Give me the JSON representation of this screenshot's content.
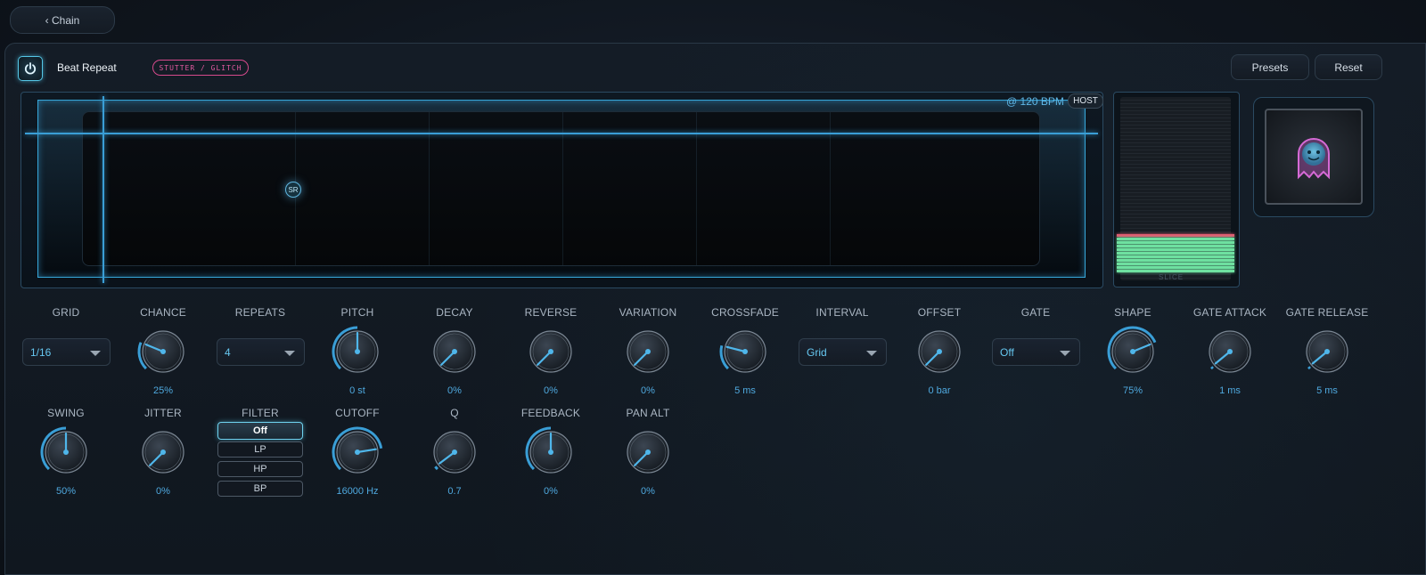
{
  "nav": {
    "back_label": "‹ Chain"
  },
  "header": {
    "title": "Beat Repeat",
    "tag": "STUTTER / GLITCH",
    "presets_label": "Presets",
    "reset_label": "Reset",
    "power_icon": "power-icon"
  },
  "display": {
    "bpm_text": "@ 120 BPM",
    "host_label": "HOST",
    "node_label": "SR",
    "slice_label": "SLICE"
  },
  "colors": {
    "accent": "#3a9ed6",
    "value_text": "#4fa9df",
    "tag": "#e25aa0",
    "meter_green": "#6fe0a0",
    "meter_red": "#e05a70"
  },
  "row1": [
    {
      "id": "grid",
      "label": "GRID",
      "type": "dropdown",
      "value": "1/16"
    },
    {
      "id": "chance",
      "label": "CHANCE",
      "type": "knob",
      "value": "25%",
      "level": 0.25
    },
    {
      "id": "repeats",
      "label": "REPEATS",
      "type": "dropdown",
      "value": "4"
    },
    {
      "id": "pitch",
      "label": "PITCH",
      "type": "knob",
      "value": "0 st",
      "level": 0.5
    },
    {
      "id": "decay",
      "label": "DECAY",
      "type": "knob",
      "value": "0%",
      "level": 0
    },
    {
      "id": "reverse",
      "label": "REVERSE",
      "type": "knob",
      "value": "0%",
      "level": 0
    },
    {
      "id": "variation",
      "label": "VARIATION",
      "type": "knob",
      "value": "0%",
      "level": 0
    },
    {
      "id": "crossfade",
      "label": "CROSSFADE",
      "type": "knob",
      "value": "5 ms",
      "level": 0.22
    },
    {
      "id": "interval",
      "label": "INTERVAL",
      "type": "dropdown",
      "value": "Grid"
    },
    {
      "id": "offset",
      "label": "OFFSET",
      "type": "knob",
      "value": "0 bar",
      "level": 0
    },
    {
      "id": "gate",
      "label": "GATE",
      "type": "dropdown",
      "value": "Off"
    },
    {
      "id": "shape",
      "label": "SHAPE",
      "type": "knob",
      "value": "75%",
      "level": 0.75
    },
    {
      "id": "gate_attack",
      "label": "GATE ATTACK",
      "type": "knob",
      "value": "1 ms",
      "level": 0.02
    },
    {
      "id": "gate_release",
      "label": "GATE RELEASE",
      "type": "knob",
      "value": "5 ms",
      "level": 0.02
    }
  ],
  "row2": [
    {
      "id": "swing",
      "label": "SWING",
      "type": "knob",
      "value": "50%",
      "level": 0.5
    },
    {
      "id": "jitter",
      "label": "JITTER",
      "type": "knob",
      "value": "0%",
      "level": 0
    },
    {
      "id": "filter",
      "label": "FILTER",
      "type": "buttons",
      "options": [
        "Off",
        "LP",
        "HP",
        "BP"
      ],
      "selected": "Off"
    },
    {
      "id": "cutoff",
      "label": "CUTOFF",
      "type": "knob",
      "value": "16000 Hz",
      "level": 0.8
    },
    {
      "id": "q",
      "label": "Q",
      "type": "knob",
      "value": "0.7",
      "level": 0.03
    },
    {
      "id": "feedback",
      "label": "FEEDBACK",
      "type": "knob",
      "value": "0%",
      "level": 0.5
    },
    {
      "id": "pan_alt",
      "label": "PAN ALT",
      "type": "knob",
      "value": "0%",
      "level": 0
    }
  ],
  "meter": {
    "green_segments": 10,
    "red_segments": 1
  }
}
